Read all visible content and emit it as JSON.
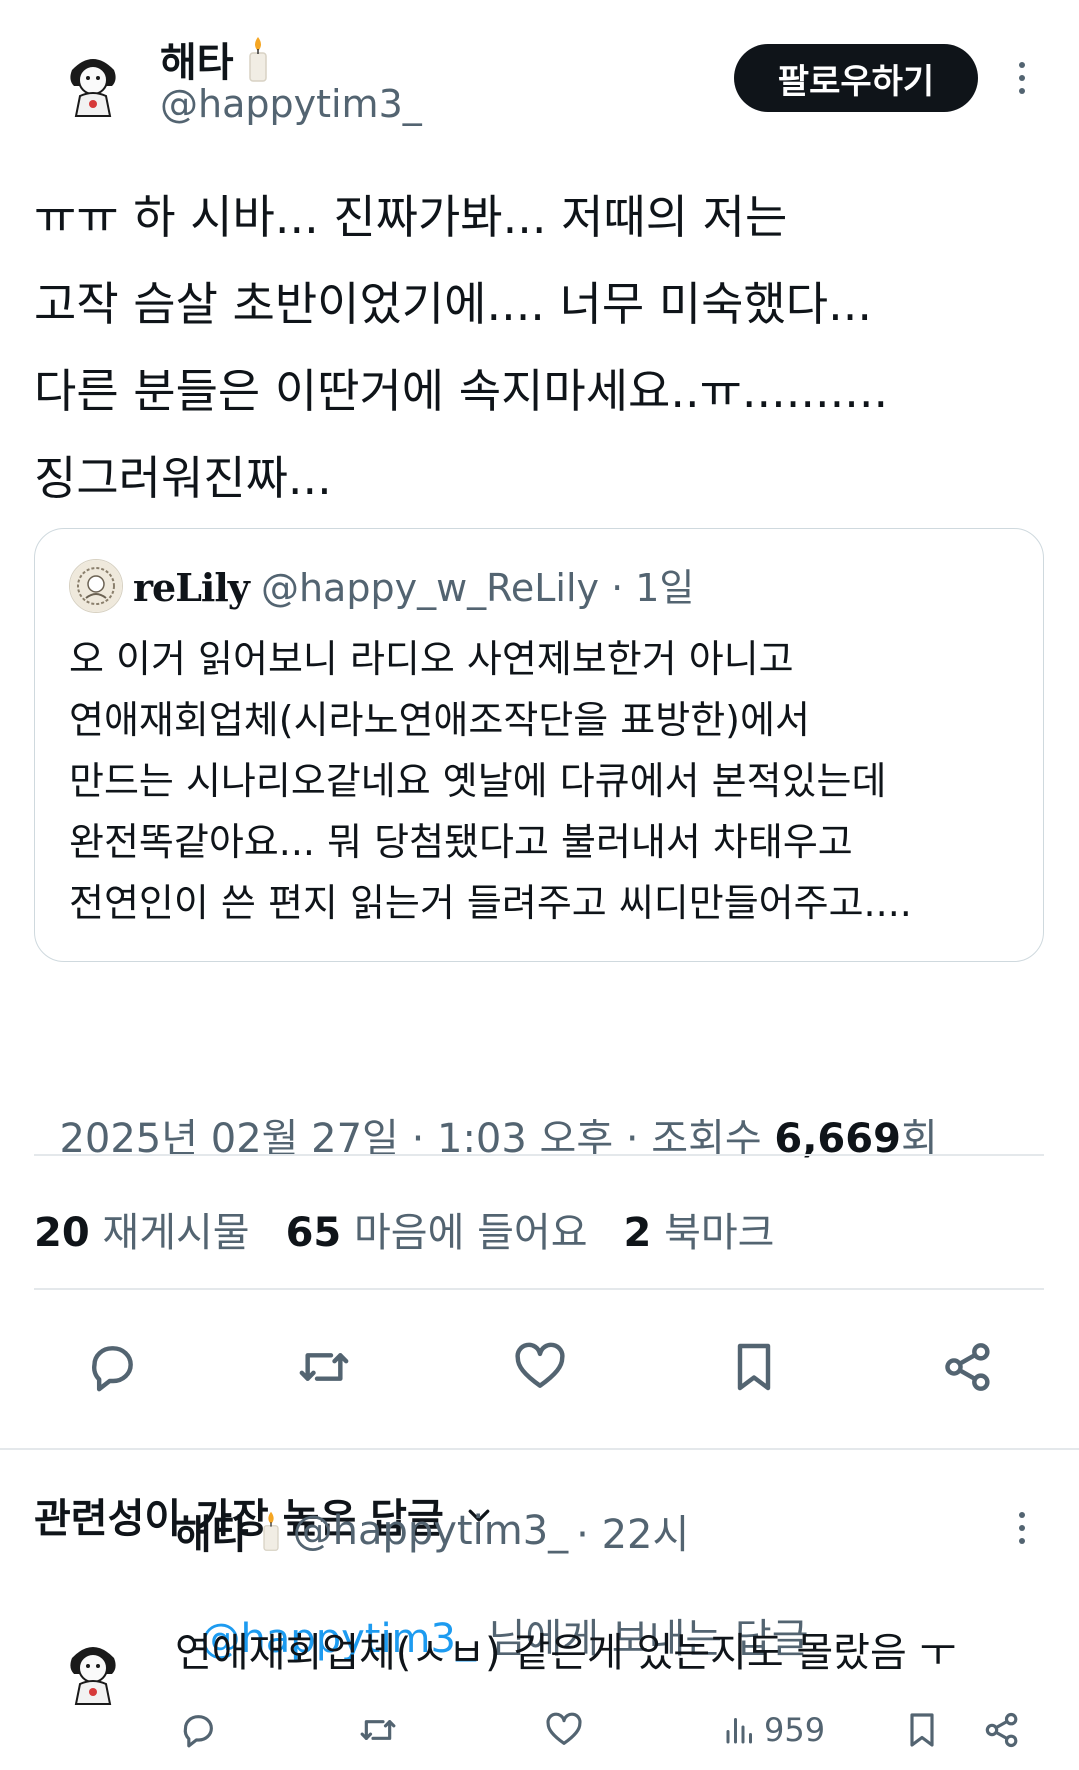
{
  "tweet": {
    "author_name": "해타",
    "author_handle": "@happytim3_",
    "follow_label": "팔로우하기",
    "text": "ㅠㅠ 하 시바... 진짜가봐... 저때의 저는\n고작 슴살 초반이었기에.... 너무 미숙했다...\n다른 분들은 이딴거에 속지마세요..ㅠ..........\n징그러워진짜...",
    "quote": {
      "author_name": "reLily",
      "author_handle": "@happy_w_ReLily",
      "time": "· 1일",
      "text": "오 이거 읽어보니 라디오 사연제보한거 아니고\n연애재회업체(시라노연애조작단을 표방한)에서\n만드는 시나리오같네요 옛날에 다큐에서 본적있는데\n완전똑같아요... 뭐 당첨됐다고 불러내서 차태우고\n전연인이 쓴 편지 읽는거 들려주고 씨디만들어주고...."
    },
    "meta": {
      "date_time": "2025년 02월 27일 · 1:03 오후 · 조회수 ",
      "views": "6,669",
      "views_suffix": "회"
    },
    "stats": {
      "reposts_count": "20",
      "reposts_label": "재게시물",
      "likes_count": "65",
      "likes_label": "마음에 들어요",
      "bookmarks_count": "2",
      "bookmarks_label": "북마크"
    }
  },
  "replies_sort": {
    "label": "관련성이 가장 높은 답글"
  },
  "reply": {
    "author_name": "해타",
    "author_handle": "@happytim3_",
    "time": "· 22시",
    "replying_to_handle": "@happytim3_",
    "replying_to_suffix": " 님에게 보내는 답글",
    "text": "연애재회업체(ㅅㅂ) 같은게 있는지도 몰랐음 ㅜ",
    "views": "959"
  },
  "icons": {
    "candle": "candle-emoji",
    "reply": "reply-icon",
    "repost": "repost-icon",
    "like": "heart-icon",
    "bookmark": "bookmark-icon",
    "share": "share-icon",
    "views": "views-icon",
    "more": "more-icon",
    "chevron": "chevron-down-icon"
  },
  "colors": {
    "text": "#0f1419",
    "muted": "#536471",
    "link": "#1d9bf0",
    "border": "#cfd9de",
    "follow_bg": "#0f1419"
  }
}
